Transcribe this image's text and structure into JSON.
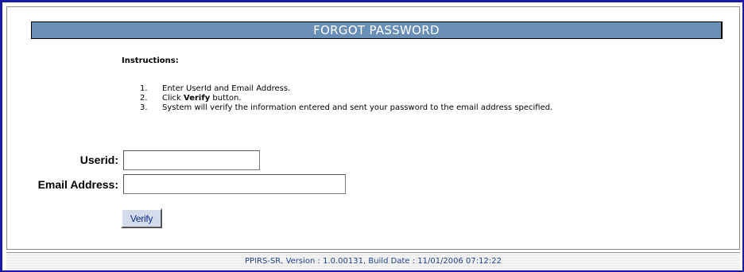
{
  "header": {
    "title": "FORGOT PASSWORD"
  },
  "instructions": {
    "heading": "Instructions:",
    "steps": [
      {
        "num": "1.",
        "text": "Enter UserId and Email Address."
      },
      {
        "num": "2.",
        "prefix": "Click ",
        "bold": "Verify",
        "suffix": " button."
      },
      {
        "num": "3.",
        "text": "System will verify the information entered and sent your password to the email address specified."
      }
    ]
  },
  "form": {
    "userid_label": "Userid:",
    "userid_value": "",
    "email_label": "Email Address:",
    "email_value": "",
    "verify_label": "Verify"
  },
  "footer": {
    "text": "PPIRS-SR, Version : 1.0.00131, Build Date : 11/01/2006 07:12:22"
  },
  "colors": {
    "frame_border": "#1a1aa6",
    "title_bar_bg": "#6a8fb7",
    "footer_text": "#1d3f8c",
    "button_bg": "#d4dcec"
  }
}
